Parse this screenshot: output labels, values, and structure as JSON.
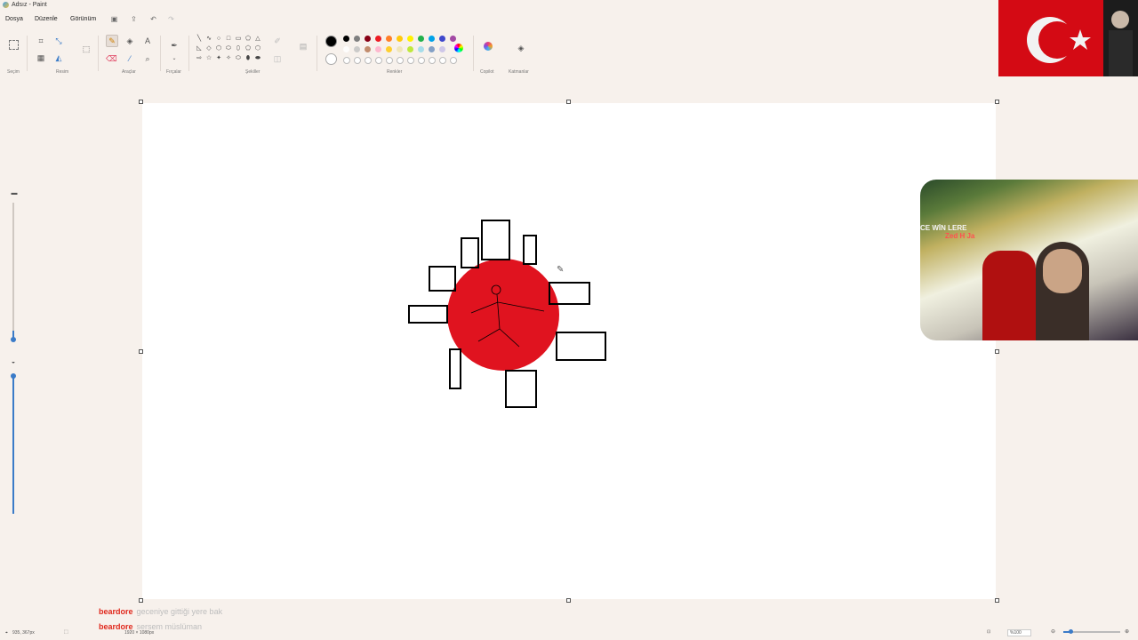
{
  "window": {
    "title": "Adsız - Paint"
  },
  "menu": {
    "file": "Dosya",
    "edit": "Düzenle",
    "view": "Görünüm"
  },
  "ribbon": {
    "groups": {
      "selection": "Seçim",
      "image": "Resim",
      "tools": "Araçlar",
      "brushes": "Fırçalar",
      "shapes": "Şekiller",
      "colors": "Renkler",
      "copilot": "Copilot",
      "layers": "Katmanlar"
    },
    "shape_glyphs": [
      "╲",
      "∿",
      "○",
      "□",
      "▭",
      "⬠",
      "△",
      "◺",
      "◇",
      "⬡",
      "⬭",
      "⬯",
      "⬠",
      "⬡",
      "⇨",
      "☆",
      "✦",
      "✧",
      "⬭",
      "⬮",
      "⬬"
    ],
    "current_colors": {
      "primary": "#000000",
      "secondary": "#ffffff"
    },
    "palette_row1": [
      "#000000",
      "#7f7f7f",
      "#880015",
      "#ed1c24",
      "#ff7f27",
      "#ffc90e",
      "#fff200",
      "#22b14c",
      "#00a2e8",
      "#3f48cc",
      "#a349a4"
    ],
    "palette_row2": [
      "#ffffff",
      "#c3c3c3",
      "#b97a57",
      "#ffaec9",
      "#ffc90e",
      "#efe4b0",
      "#b5e61d",
      "#99d9ea",
      "#7092be",
      "#c8bfe7"
    ]
  },
  "drawing": {
    "circle_color": "#e0131f",
    "stroke_color": "#000000"
  },
  "chat": [
    {
      "user": "beardore",
      "message": "geceniye gittiği yere bak"
    },
    {
      "user": "beardore",
      "message": "sersem müslüman"
    }
  ],
  "statusbar": {
    "cursor": "935, 367px",
    "canvas_size": "1920 × 1080px",
    "zoom": "%100"
  },
  "webcam": {
    "neon_text_1": "CE WİN LERE",
    "neon_text_2": "Zed H Ja"
  }
}
